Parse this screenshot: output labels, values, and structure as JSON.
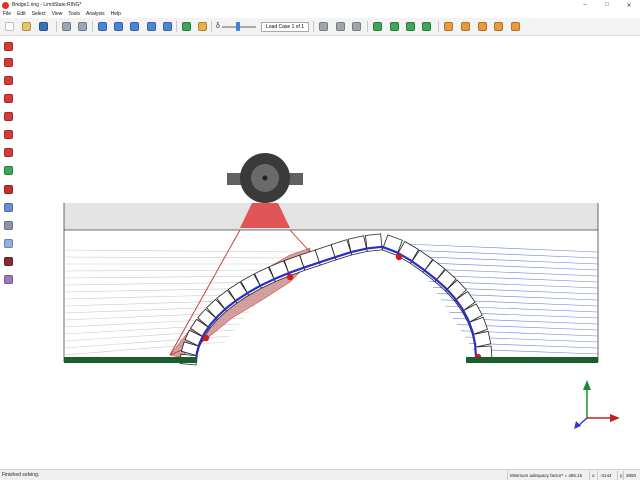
{
  "window": {
    "title": "Bridge1.ring - LimitState:RING*",
    "minimize_glyph": "–",
    "maximize_glyph": "□",
    "close_glyph": "✕"
  },
  "menu": [
    "File",
    "Edit",
    "Select",
    "View",
    "Tools",
    "Analysis",
    "Help"
  ],
  "toolbar": {
    "load_case_label": "Load Case 1 of 1",
    "delta_symbol": "δ",
    "buttons": [
      {
        "name": "new-file-icon",
        "color": "#ffffff"
      },
      {
        "name": "open-folder-icon",
        "color": "#e9c46a"
      },
      {
        "name": "save-icon",
        "color": "#3b6fb6"
      },
      {
        "name": "undo-icon",
        "color": "#9aa7b6"
      },
      {
        "name": "redo-icon",
        "color": "#9aa7b6"
      },
      {
        "name": "select-icon",
        "color": "#4a86d8"
      },
      {
        "name": "zoom-icon",
        "color": "#4a86d8"
      },
      {
        "name": "pan-icon",
        "color": "#4a86d8"
      },
      {
        "name": "rotate-icon",
        "color": "#4a86d8"
      },
      {
        "name": "view-icon",
        "color": "#4a86d8"
      },
      {
        "name": "run-icon",
        "color": "#3aa856"
      },
      {
        "name": "lock-icon",
        "color": "#e8b04a"
      },
      {
        "name": "wrench-icon",
        "color": "#a0a6ae"
      },
      {
        "name": "measure-icon",
        "color": "#a0a6ae"
      },
      {
        "name": "probe-icon",
        "color": "#a0a6ae"
      },
      {
        "name": "report-icon",
        "color": "#3aa856"
      },
      {
        "name": "export-icon",
        "color": "#3aa856"
      },
      {
        "name": "table-icon",
        "color": "#3aa856"
      },
      {
        "name": "check-icon",
        "color": "#3aa856"
      },
      {
        "name": "results-icon",
        "color": "#e89a3c"
      },
      {
        "name": "plot-icon",
        "color": "#e89a3c"
      },
      {
        "name": "chart-icon",
        "color": "#e89a3c"
      },
      {
        "name": "stats-icon",
        "color": "#e89a3c"
      },
      {
        "name": "output-icon",
        "color": "#e89a3c"
      }
    ]
  },
  "left_toolbar": [
    {
      "name": "arch-icon",
      "color": "#d63b3b"
    },
    {
      "name": "barrel-icon",
      "color": "#d63b3b"
    },
    {
      "name": "spandrel-icon",
      "color": "#d63b3b"
    },
    {
      "name": "fill-icon",
      "color": "#d63b3b"
    },
    {
      "name": "backfill-icon",
      "color": "#d63b3b"
    },
    {
      "name": "load-icon",
      "color": "#d63b3b"
    },
    {
      "name": "support-icon",
      "color": "#d63b3b"
    },
    {
      "name": "axle-icon",
      "color": "#3aa856"
    },
    {
      "name": "block-red-icon",
      "color": "#c43030"
    },
    {
      "name": "block-blue-icon",
      "color": "#6a8ed8"
    },
    {
      "name": "block-grey-icon",
      "color": "#8b96a8"
    },
    {
      "name": "block-lightblue-icon",
      "color": "#8fb0e0"
    },
    {
      "name": "block-darkred-icon",
      "color": "#8a2a2a"
    },
    {
      "name": "block-purple-icon",
      "color": "#9a7ab8"
    }
  ],
  "status": {
    "message": "Finished solving.",
    "adequacy": "Minimum adequacy factor* = 455.15",
    "x_coord": "-3144",
    "y_coord": "3650",
    "x_label": "x:",
    "y_label": "y:"
  },
  "colors": {
    "ground": "#1a5e2e",
    "fill_band": "#e3e3e3",
    "thrust_line": "#2a2fc4",
    "hinge": "#d41a1a",
    "load_patch": "#e05555",
    "dispersion_left": "#c44b4b",
    "dispersion_right": "#4a5fd8"
  }
}
